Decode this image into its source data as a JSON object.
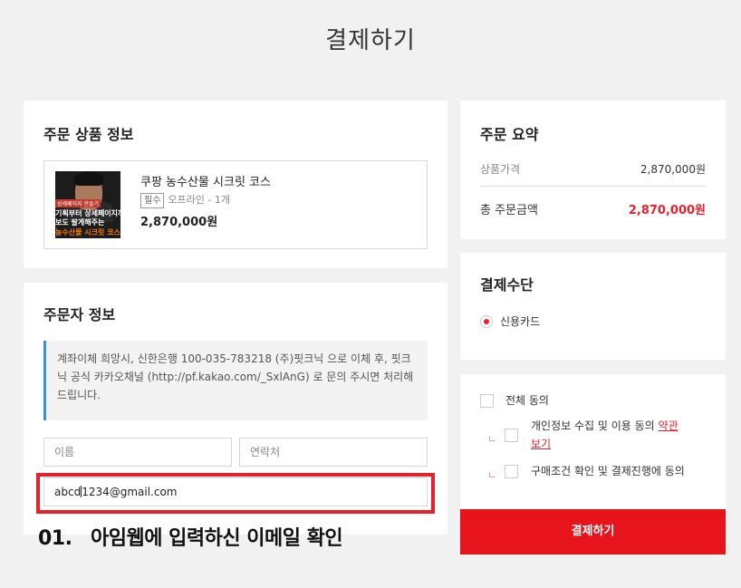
{
  "page": {
    "title": "결제하기"
  },
  "product_section": {
    "heading": "주문 상품 정보",
    "item": {
      "name": "쿠팡 농수산물 시크릿 코스",
      "badge": "필수",
      "meta": "오프라인 - 1개",
      "price": "2,870,000원",
      "thumbnail": {
        "tag": "상세페이지 만들기",
        "line1": "기획부터 상세페이지까지 제공",
        "line2": "보도 팔게해주는",
        "line3": "농수산물 시크릿 코스"
      }
    }
  },
  "buyer_section": {
    "heading": "주문자 정보",
    "notice": "계좌이체 희망시, 신한은행 100-035-783218 (주)핏크닉 으로 이체 후, 핏크닉 공식 카카오채널 (http://pf.kakao.com/_SxlAnG) 로 문의 주시면 처리해드립니다.",
    "name_placeholder": "이름",
    "phone_placeholder": "연락처",
    "email_value_before_caret": "abcd",
    "email_value_after_caret": "1234@gmail.com"
  },
  "annotation": {
    "step_number": "01.",
    "step_text": "아임웹에 입력하신 이메일 확인",
    "color": "#e8222c"
  },
  "summary_section": {
    "heading": "주문 요약",
    "goods_label": "상품가격",
    "goods_value": "2,870,000원",
    "total_label": "총 주문금액",
    "total_value": "2,870,000원"
  },
  "payment_section": {
    "heading": "결제수단",
    "method": "신용카드"
  },
  "agreements": {
    "all": "전체 동의",
    "privacy_prefix": "개인정보 수집 및 이용 동의",
    "privacy_link_1": "약관",
    "privacy_link_2": "보기",
    "purchase": "구매조건 확인 및 결제진행에 동의",
    "sub_mark": "ㄴ"
  },
  "pay_button": {
    "label": "결제하기",
    "color": "#e8141c"
  }
}
